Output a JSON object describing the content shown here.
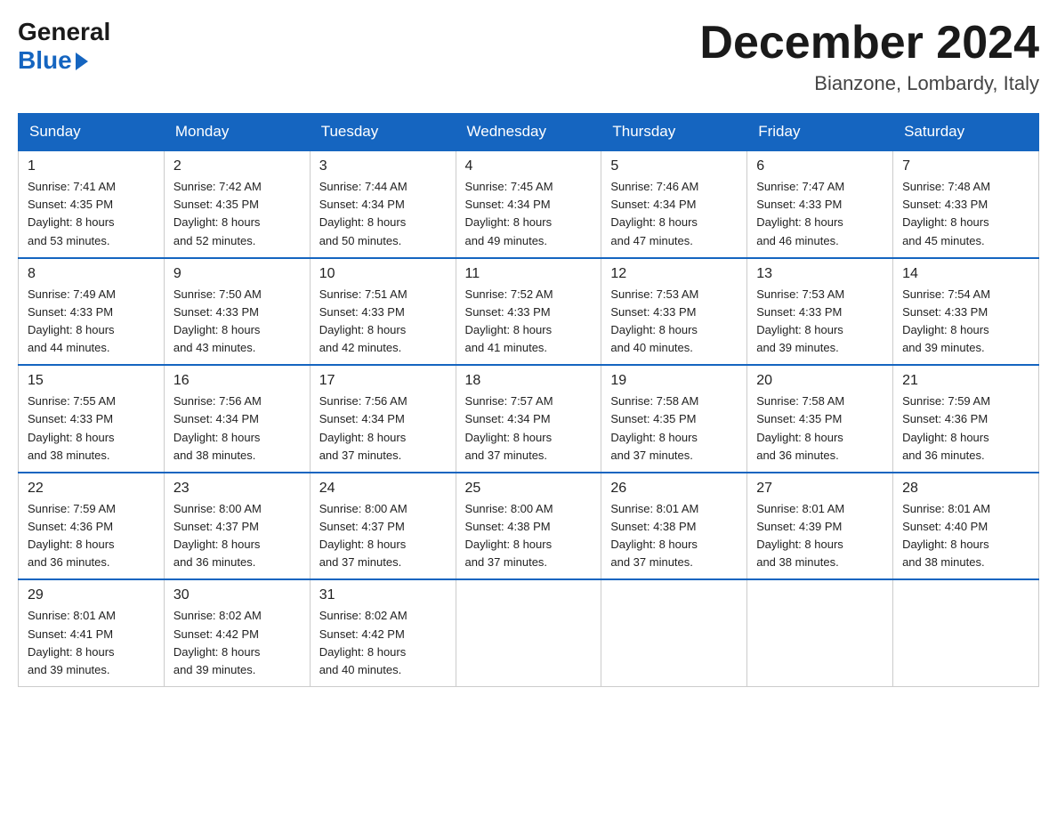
{
  "logo": {
    "general": "General",
    "blue": "Blue"
  },
  "title": "December 2024",
  "location": "Bianzone, Lombardy, Italy",
  "days_of_week": [
    "Sunday",
    "Monday",
    "Tuesday",
    "Wednesday",
    "Thursday",
    "Friday",
    "Saturday"
  ],
  "weeks": [
    [
      {
        "day": "1",
        "sunrise": "7:41 AM",
        "sunset": "4:35 PM",
        "daylight": "8 hours and 53 minutes."
      },
      {
        "day": "2",
        "sunrise": "7:42 AM",
        "sunset": "4:35 PM",
        "daylight": "8 hours and 52 minutes."
      },
      {
        "day": "3",
        "sunrise": "7:44 AM",
        "sunset": "4:34 PM",
        "daylight": "8 hours and 50 minutes."
      },
      {
        "day": "4",
        "sunrise": "7:45 AM",
        "sunset": "4:34 PM",
        "daylight": "8 hours and 49 minutes."
      },
      {
        "day": "5",
        "sunrise": "7:46 AM",
        "sunset": "4:34 PM",
        "daylight": "8 hours and 47 minutes."
      },
      {
        "day": "6",
        "sunrise": "7:47 AM",
        "sunset": "4:33 PM",
        "daylight": "8 hours and 46 minutes."
      },
      {
        "day": "7",
        "sunrise": "7:48 AM",
        "sunset": "4:33 PM",
        "daylight": "8 hours and 45 minutes."
      }
    ],
    [
      {
        "day": "8",
        "sunrise": "7:49 AM",
        "sunset": "4:33 PM",
        "daylight": "8 hours and 44 minutes."
      },
      {
        "day": "9",
        "sunrise": "7:50 AM",
        "sunset": "4:33 PM",
        "daylight": "8 hours and 43 minutes."
      },
      {
        "day": "10",
        "sunrise": "7:51 AM",
        "sunset": "4:33 PM",
        "daylight": "8 hours and 42 minutes."
      },
      {
        "day": "11",
        "sunrise": "7:52 AM",
        "sunset": "4:33 PM",
        "daylight": "8 hours and 41 minutes."
      },
      {
        "day": "12",
        "sunrise": "7:53 AM",
        "sunset": "4:33 PM",
        "daylight": "8 hours and 40 minutes."
      },
      {
        "day": "13",
        "sunrise": "7:53 AM",
        "sunset": "4:33 PM",
        "daylight": "8 hours and 39 minutes."
      },
      {
        "day": "14",
        "sunrise": "7:54 AM",
        "sunset": "4:33 PM",
        "daylight": "8 hours and 39 minutes."
      }
    ],
    [
      {
        "day": "15",
        "sunrise": "7:55 AM",
        "sunset": "4:33 PM",
        "daylight": "8 hours and 38 minutes."
      },
      {
        "day": "16",
        "sunrise": "7:56 AM",
        "sunset": "4:34 PM",
        "daylight": "8 hours and 38 minutes."
      },
      {
        "day": "17",
        "sunrise": "7:56 AM",
        "sunset": "4:34 PM",
        "daylight": "8 hours and 37 minutes."
      },
      {
        "day": "18",
        "sunrise": "7:57 AM",
        "sunset": "4:34 PM",
        "daylight": "8 hours and 37 minutes."
      },
      {
        "day": "19",
        "sunrise": "7:58 AM",
        "sunset": "4:35 PM",
        "daylight": "8 hours and 37 minutes."
      },
      {
        "day": "20",
        "sunrise": "7:58 AM",
        "sunset": "4:35 PM",
        "daylight": "8 hours and 36 minutes."
      },
      {
        "day": "21",
        "sunrise": "7:59 AM",
        "sunset": "4:36 PM",
        "daylight": "8 hours and 36 minutes."
      }
    ],
    [
      {
        "day": "22",
        "sunrise": "7:59 AM",
        "sunset": "4:36 PM",
        "daylight": "8 hours and 36 minutes."
      },
      {
        "day": "23",
        "sunrise": "8:00 AM",
        "sunset": "4:37 PM",
        "daylight": "8 hours and 36 minutes."
      },
      {
        "day": "24",
        "sunrise": "8:00 AM",
        "sunset": "4:37 PM",
        "daylight": "8 hours and 37 minutes."
      },
      {
        "day": "25",
        "sunrise": "8:00 AM",
        "sunset": "4:38 PM",
        "daylight": "8 hours and 37 minutes."
      },
      {
        "day": "26",
        "sunrise": "8:01 AM",
        "sunset": "4:38 PM",
        "daylight": "8 hours and 37 minutes."
      },
      {
        "day": "27",
        "sunrise": "8:01 AM",
        "sunset": "4:39 PM",
        "daylight": "8 hours and 38 minutes."
      },
      {
        "day": "28",
        "sunrise": "8:01 AM",
        "sunset": "4:40 PM",
        "daylight": "8 hours and 38 minutes."
      }
    ],
    [
      {
        "day": "29",
        "sunrise": "8:01 AM",
        "sunset": "4:41 PM",
        "daylight": "8 hours and 39 minutes."
      },
      {
        "day": "30",
        "sunrise": "8:02 AM",
        "sunset": "4:42 PM",
        "daylight": "8 hours and 39 minutes."
      },
      {
        "day": "31",
        "sunrise": "8:02 AM",
        "sunset": "4:42 PM",
        "daylight": "8 hours and 40 minutes."
      },
      null,
      null,
      null,
      null
    ]
  ],
  "labels": {
    "sunrise": "Sunrise:",
    "sunset": "Sunset:",
    "daylight": "Daylight:"
  }
}
